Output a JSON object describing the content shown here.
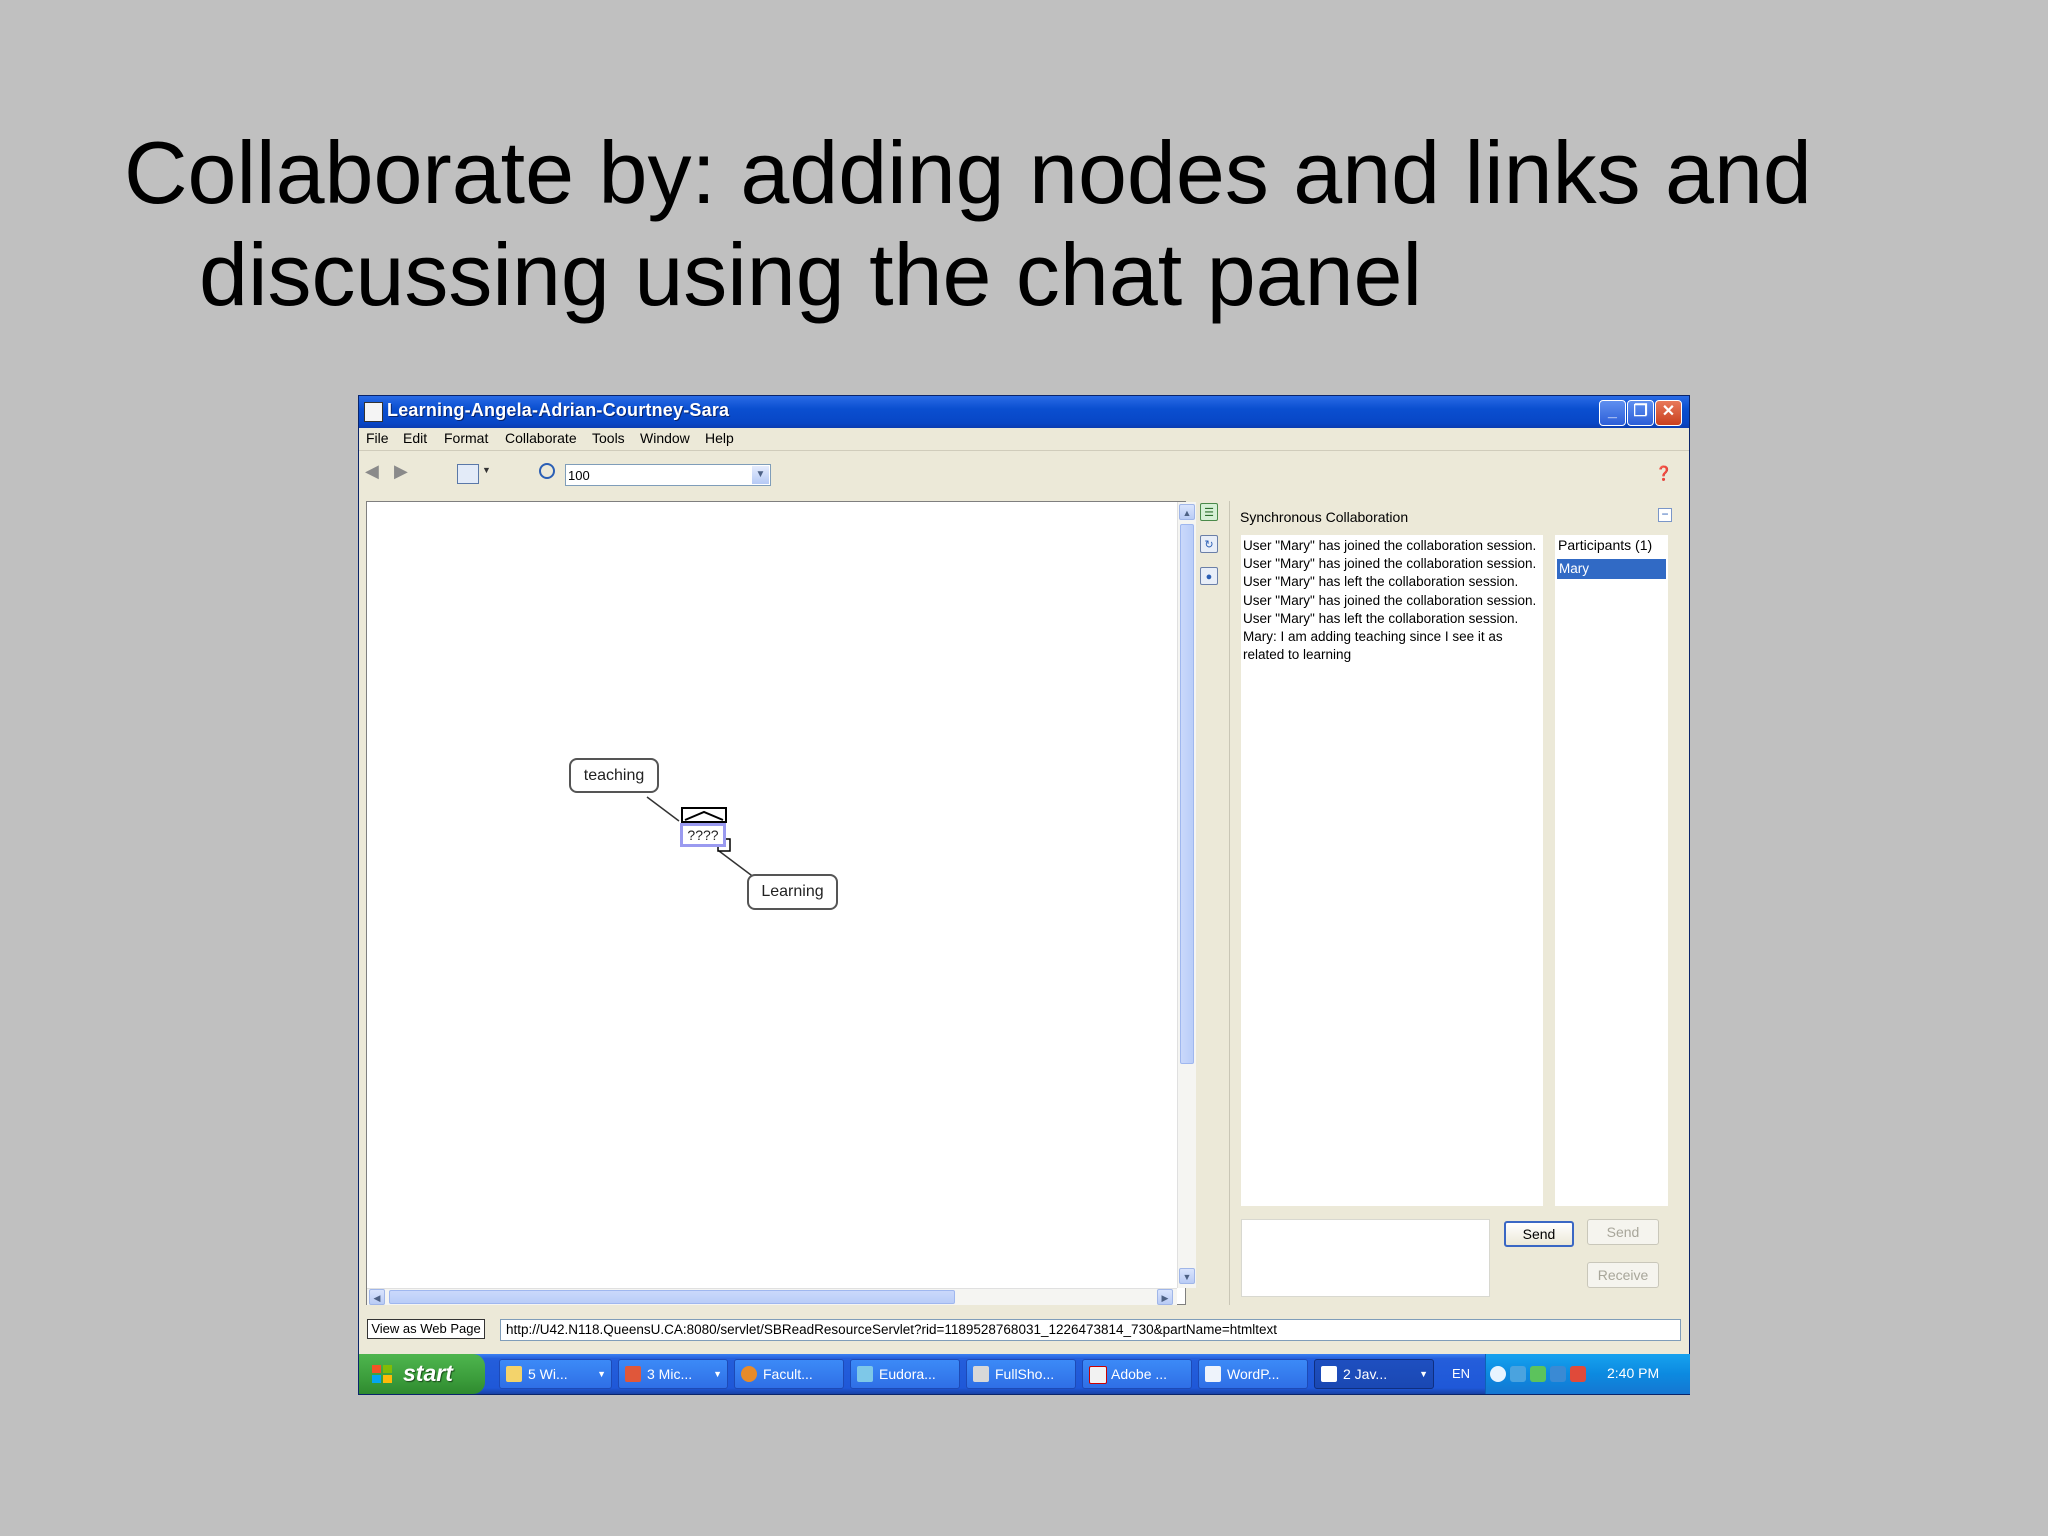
{
  "slide": {
    "title_line1": "Collaborate by: adding nodes and links and",
    "title_line2": "discussing using the chat panel"
  },
  "window": {
    "title": "Learning-Angela-Adrian-Courtney-Sara",
    "minimize": "_",
    "maximize": "❐",
    "close": "✕"
  },
  "menu": [
    "File",
    "Edit",
    "Format",
    "Collaborate",
    "Tools",
    "Window",
    "Help"
  ],
  "toolbar": {
    "zoom_value": "100"
  },
  "concept_map": {
    "nodes": [
      "teaching",
      "Learning"
    ],
    "link_label": "????"
  },
  "collaboration": {
    "title": "Synchronous Collaboration",
    "collapse": "−",
    "messages": [
      "User \"Mary\" has joined the collaboration session.",
      "User \"Mary\" has joined the collaboration session.",
      "User \"Mary\" has left the collaboration session.",
      "User \"Mary\" has joined the collaboration session.",
      "User \"Mary\" has left the collaboration session.",
      "Mary: I am adding teaching since I see it as related to learning"
    ],
    "participants_header": "Participants (1)",
    "participants": [
      "Mary"
    ],
    "chat_input_value": "",
    "send_label": "Send",
    "send2_label": "Send",
    "receive_label": "Receive"
  },
  "statusbar": {
    "view_web_label": "View as Web Page",
    "url": "http://U42.N118.QueensU.CA:8080/servlet/SBReadResourceServlet?rid=1189528768031_1226473814_730&partName=htmltext"
  },
  "taskbar": {
    "start_label": "start",
    "buttons": [
      "5 Wi...",
      "3 Mic...",
      "Facult...",
      "Eudora...",
      "FullSho...",
      "Adobe ...",
      "WordP...",
      "2 Jav..."
    ],
    "language": "EN",
    "clock": "2:40 PM"
  },
  "colors": {
    "slide_bg": "#c0c0c0",
    "titlebar": "#0a4fd0",
    "selection": "#316ac5",
    "taskbar": "#245edb",
    "start_green": "#3c9e3c"
  }
}
